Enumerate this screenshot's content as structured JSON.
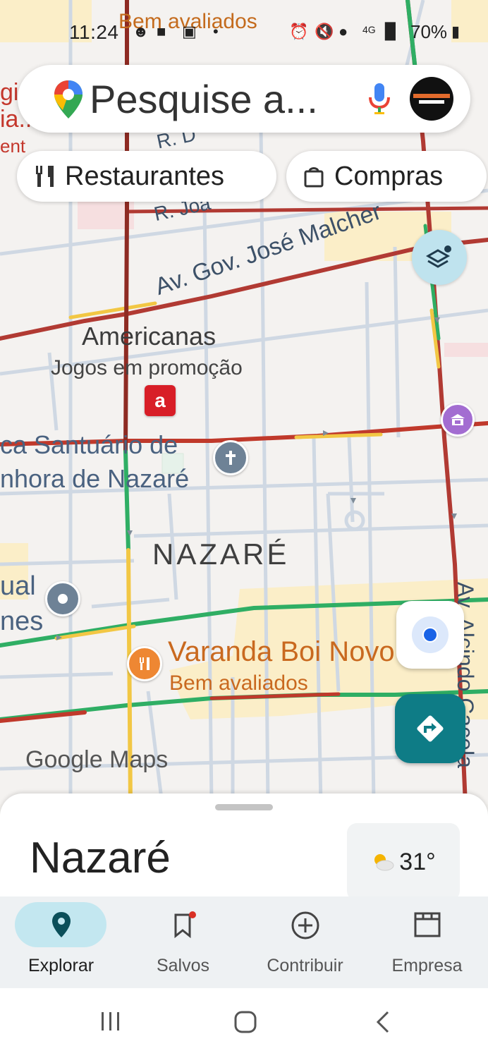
{
  "status_bar": {
    "time": "11:24",
    "network": "4G",
    "battery": "70%"
  },
  "search": {
    "placeholder": "Pesquise a..."
  },
  "chips": [
    {
      "label": "Restaurantes",
      "icon": "fork-knife-icon"
    },
    {
      "label": "Compras",
      "icon": "shopping-bag-icon"
    }
  ],
  "map": {
    "top_label": "Bem avaliados",
    "streets": {
      "r_d": "R. D",
      "r_joa": "R. Joa",
      "jose_malcher": "Av. Gov. José Malcher",
      "alcindo": "Av. Alcindo Cacela"
    },
    "places": {
      "americanas_name": "Americanas",
      "americanas_sub": "Jogos em promoção",
      "americanas_logo": "a",
      "basilica_line1": "ca Santuário de",
      "basilica_line2": "nhora de Nazaré",
      "neighborhood": "NAZARÉ",
      "left_line1": "ual",
      "left_line2": "nes",
      "varanda_name": "Varanda Boi Novo",
      "varanda_sub": "Bem avaliados",
      "left_top1": "gi",
      "left_top2": "ia...",
      "left_top3": "ent"
    },
    "watermark": "Google Maps"
  },
  "sheet": {
    "title": "Nazaré",
    "weather": "31°"
  },
  "bottom_nav": [
    {
      "label": "Explorar",
      "icon": "explore-pin-icon",
      "active": true
    },
    {
      "label": "Salvos",
      "icon": "bookmark-icon",
      "active": false
    },
    {
      "label": "Contribuir",
      "icon": "add-circle-icon",
      "active": false
    },
    {
      "label": "Empresa",
      "icon": "storefront-icon",
      "active": false
    }
  ],
  "colors": {
    "accent": "#0e7c86",
    "orange": "#e8711c",
    "map_bg": "#f3f1ee"
  }
}
